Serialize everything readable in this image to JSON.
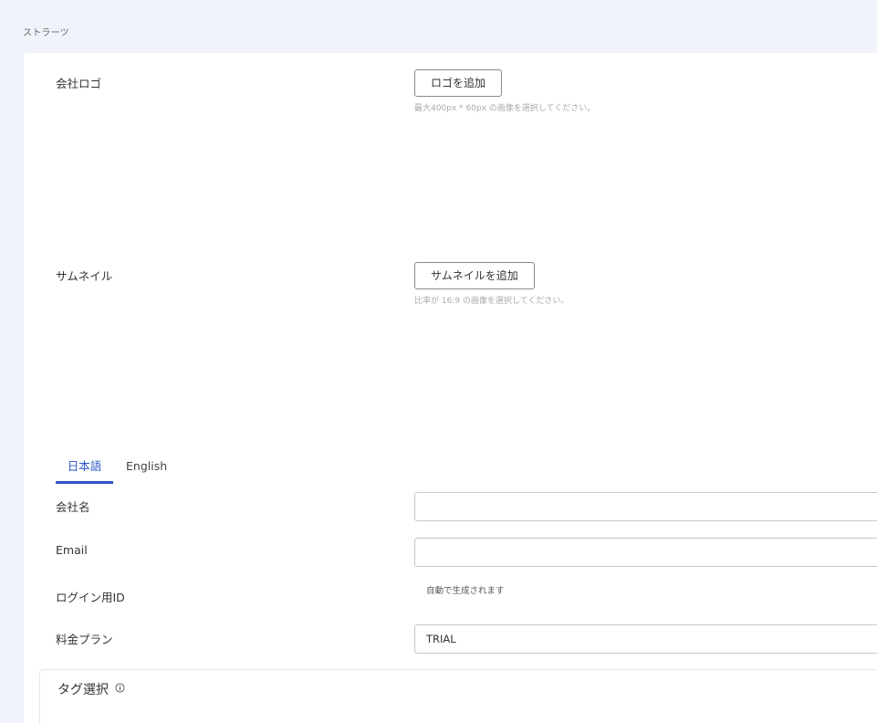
{
  "breadcrumb": "ストラーツ",
  "logo_section": {
    "label": "会社ロゴ",
    "button_label": "ロゴを追加",
    "hint": "最大400px * 60px の画像を選択してください。"
  },
  "thumbnail_section": {
    "label": "サムネイル",
    "button_label": "サムネイルを追加",
    "hint": "比率が 16:9 の画像を選択してください。"
  },
  "language_tabs": [
    {
      "label": "日本語",
      "active": true
    },
    {
      "label": "English",
      "active": false
    }
  ],
  "form": {
    "company_name": {
      "label": "会社名",
      "value": ""
    },
    "email": {
      "label": "Email",
      "value": ""
    },
    "login_id": {
      "label": "ログイン用ID",
      "value": "自動で生成されます"
    },
    "plan": {
      "label": "料金プラン",
      "value": "TRIAL"
    }
  },
  "tag_section": {
    "title": "タグ選択",
    "icon": "info-icon"
  },
  "colors": {
    "accent": "#2d55c5",
    "background": "#f1f3fa",
    "card": "#ffffff"
  }
}
